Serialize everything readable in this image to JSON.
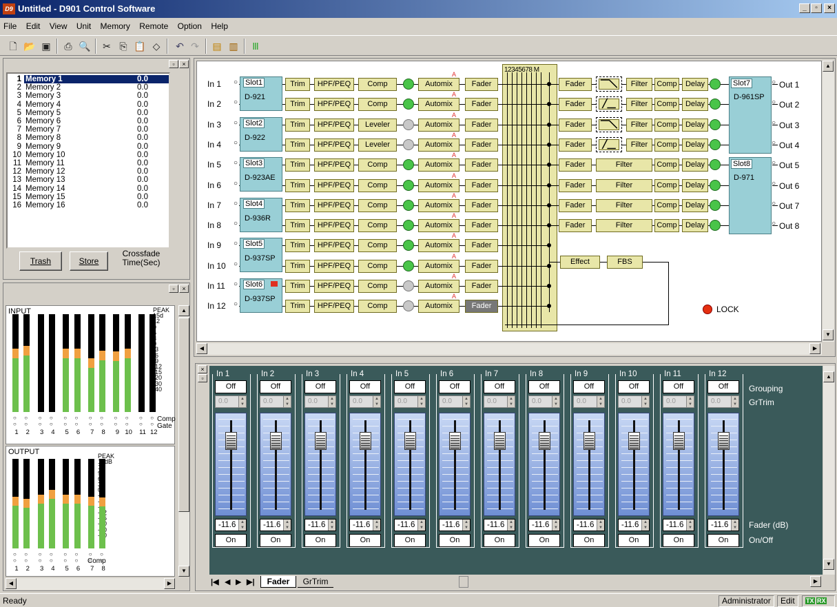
{
  "window": {
    "title": "Untitled - D901 Control Software",
    "app_icon": "D9"
  },
  "menu": [
    "File",
    "Edit",
    "View",
    "Unit",
    "Memory",
    "Remote",
    "Option",
    "Help"
  ],
  "memory_list": [
    {
      "n": "1",
      "name": "Memory 1",
      "val": "0.0"
    },
    {
      "n": "2",
      "name": "Memory 2",
      "val": "0.0"
    },
    {
      "n": "3",
      "name": "Memory 3",
      "val": "0.0"
    },
    {
      "n": "4",
      "name": "Memory 4",
      "val": "0.0"
    },
    {
      "n": "5",
      "name": "Memory 5",
      "val": "0.0"
    },
    {
      "n": "6",
      "name": "Memory 6",
      "val": "0.0"
    },
    {
      "n": "7",
      "name": "Memory 7",
      "val": "0.0"
    },
    {
      "n": "8",
      "name": "Memory 8",
      "val": "0.0"
    },
    {
      "n": "9",
      "name": "Memory 9",
      "val": "0.0"
    },
    {
      "n": "10",
      "name": "Memory 10",
      "val": "0.0"
    },
    {
      "n": "11",
      "name": "Memory 11",
      "val": "0.0"
    },
    {
      "n": "12",
      "name": "Memory 12",
      "val": "0.0"
    },
    {
      "n": "13",
      "name": "Memory 13",
      "val": "0.0"
    },
    {
      "n": "14",
      "name": "Memory 14",
      "val": "0.0"
    },
    {
      "n": "15",
      "name": "Memory 15",
      "val": "0.0"
    },
    {
      "n": "16",
      "name": "Memory 16",
      "val": "0.0"
    }
  ],
  "memory_buttons": {
    "trash": "Trash",
    "store": "Store",
    "crossfade": "Crossfade",
    "crossfade_unit": "Time(Sec)"
  },
  "meters": {
    "input_label": "INPUT",
    "output_label": "OUTPUT",
    "peak": "PEAK",
    "input_scale": [
      "15d",
      "12",
      "9",
      "6",
      "3",
      "0",
      "-3",
      "-6",
      "-9",
      "-12",
      "-15",
      "-20",
      "-30",
      "-40"
    ],
    "output_scale": [
      "15dB",
      "12",
      "9",
      "6",
      "3",
      "0",
      "-3",
      "-6",
      "-9",
      "-12",
      "-15",
      "-20",
      "-30",
      "-40"
    ],
    "comp": "Comp",
    "gate": "Gate",
    "input_numbers": [
      "1",
      "2",
      "3",
      "4",
      "5",
      "6",
      "7",
      "8",
      "9",
      "10",
      "11",
      "12"
    ],
    "output_numbers": [
      "1",
      "2",
      "3",
      "4",
      "5",
      "6",
      "7",
      "8"
    ],
    "input_levels": [
      0.55,
      0.58,
      0,
      0,
      0.55,
      0.55,
      0.45,
      0.53,
      0.52,
      0.55,
      0,
      0
    ],
    "output_levels": [
      0.48,
      0.45,
      0.5,
      0.55,
      0.5,
      0.5,
      0.48,
      0.47
    ]
  },
  "diagram": {
    "inputs": [
      "In 1",
      "In 2",
      "In 3",
      "In 4",
      "In 5",
      "In 6",
      "In 7",
      "In 8",
      "In 9",
      "In 10",
      "In 11",
      "In 12"
    ],
    "outputs": [
      "Out 1",
      "Out 2",
      "Out 3",
      "Out 4",
      "Out 5",
      "Out 6",
      "Out 7",
      "Out 8"
    ],
    "slots_in": [
      {
        "slot": "Slot1",
        "model": "D-921"
      },
      {
        "slot": "Slot2",
        "model": "D-922"
      },
      {
        "slot": "Slot3",
        "model": "D-923AE"
      },
      {
        "slot": "Slot4",
        "model": "D-936R"
      },
      {
        "slot": "Slot5",
        "model": "D-937SP"
      },
      {
        "slot": "Slot6",
        "model": "D-937SP"
      }
    ],
    "slots_out": [
      {
        "slot": "Slot7",
        "model": "D-961SP"
      },
      {
        "slot": "Slot8",
        "model": "D-971"
      }
    ],
    "labels": {
      "trim": "Trim",
      "hpf": "HPF/PEQ",
      "comp": "Comp",
      "leveler": "Leveler",
      "automix": "Automix",
      "fader": "Fader",
      "filter": "Filter",
      "delay": "Delay",
      "effect": "Effect",
      "fbs": "FBS",
      "A": "A",
      "matrix_header": "12345678 M"
    },
    "lock": "LOCK"
  },
  "mixer": {
    "channels": [
      "In 1",
      "In 2",
      "In 3",
      "In 4",
      "In 5",
      "In 6",
      "In 7",
      "In 8",
      "In 9",
      "In 10",
      "In 11",
      "In 12"
    ],
    "group_btn": "Off",
    "grtrim": "0.0",
    "fader_db": "-11.6",
    "fader_position": 0.13,
    "onoff": "On",
    "row_labels": {
      "grouping": "Grouping",
      "grtrim": "GrTrim",
      "fader": "Fader (dB)",
      "onoff": "On/Off"
    },
    "tabs": [
      "Fader",
      "GrTrim"
    ]
  },
  "status": {
    "text": "Ready",
    "user": "Administrator",
    "mode": "Edit",
    "tx": "TX",
    "rx": "RX"
  }
}
